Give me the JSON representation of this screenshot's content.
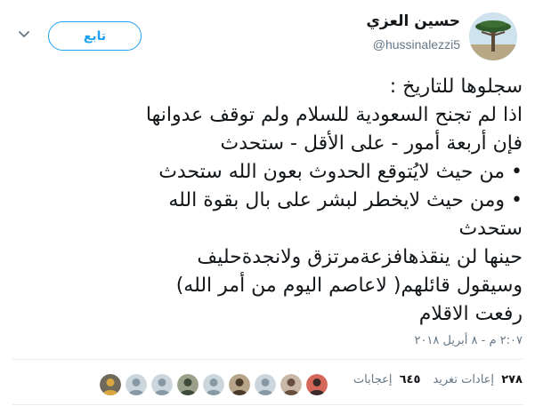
{
  "user": {
    "display_name": "حسين العزي",
    "handle": "@hussinalezzi5",
    "avatar_icon": "dragon-blood-tree-avatar"
  },
  "follow_button": {
    "label": "تابع",
    "color": "#1da1f2"
  },
  "menu": {
    "icon": "chevron-down-icon"
  },
  "tweet": {
    "lines": [
      "سجلوها للتاريخ :",
      "اذا لم تجنح السعودية للسلام ولم توقف عدوانها",
      "فإن أربعة أمور  - على الأقل - ستحدث",
      "• من حيث لايُتوقع الحدوث بعون الله ستحدث",
      "• ومن حيث لايخطر لبشر على بال بقوة الله",
      "ستحدث",
      "حينها لن ينقذهافزعةمرتزق ولانجدةحليف",
      "وسيقول قائلهم( لاعاصم اليوم من أمر الله)",
      "رفعت الاقلام"
    ],
    "timestamp": "٢:٠٧ م - ٨ أبريل ٢٠١٨"
  },
  "stats": {
    "retweets_count": "٢٧٨",
    "retweets_label": "إعادات تغريد",
    "likes_count": "٦٤٥",
    "likes_label": "إعجابات"
  },
  "liker_avatars": [
    {
      "kind": "photo",
      "bg": "#d4675a",
      "fg": "#3a2a2a"
    },
    {
      "kind": "photo",
      "bg": "#c9b8a8",
      "fg": "#6a4e3e"
    },
    {
      "kind": "default",
      "bg": "#ccd6dd",
      "fg": "#8899a6"
    },
    {
      "kind": "photo",
      "bg": "#b8a488",
      "fg": "#4a3a2a"
    },
    {
      "kind": "default",
      "bg": "#ccd6dd",
      "fg": "#8899a6"
    },
    {
      "kind": "photo",
      "bg": "#9aa08a",
      "fg": "#3e4a3a"
    },
    {
      "kind": "default",
      "bg": "#ccd6dd",
      "fg": "#8899a6"
    },
    {
      "kind": "default",
      "bg": "#ccd6dd",
      "fg": "#8899a6"
    },
    {
      "kind": "photo",
      "bg": "#6e6a5a",
      "fg": "#d9a640"
    }
  ]
}
